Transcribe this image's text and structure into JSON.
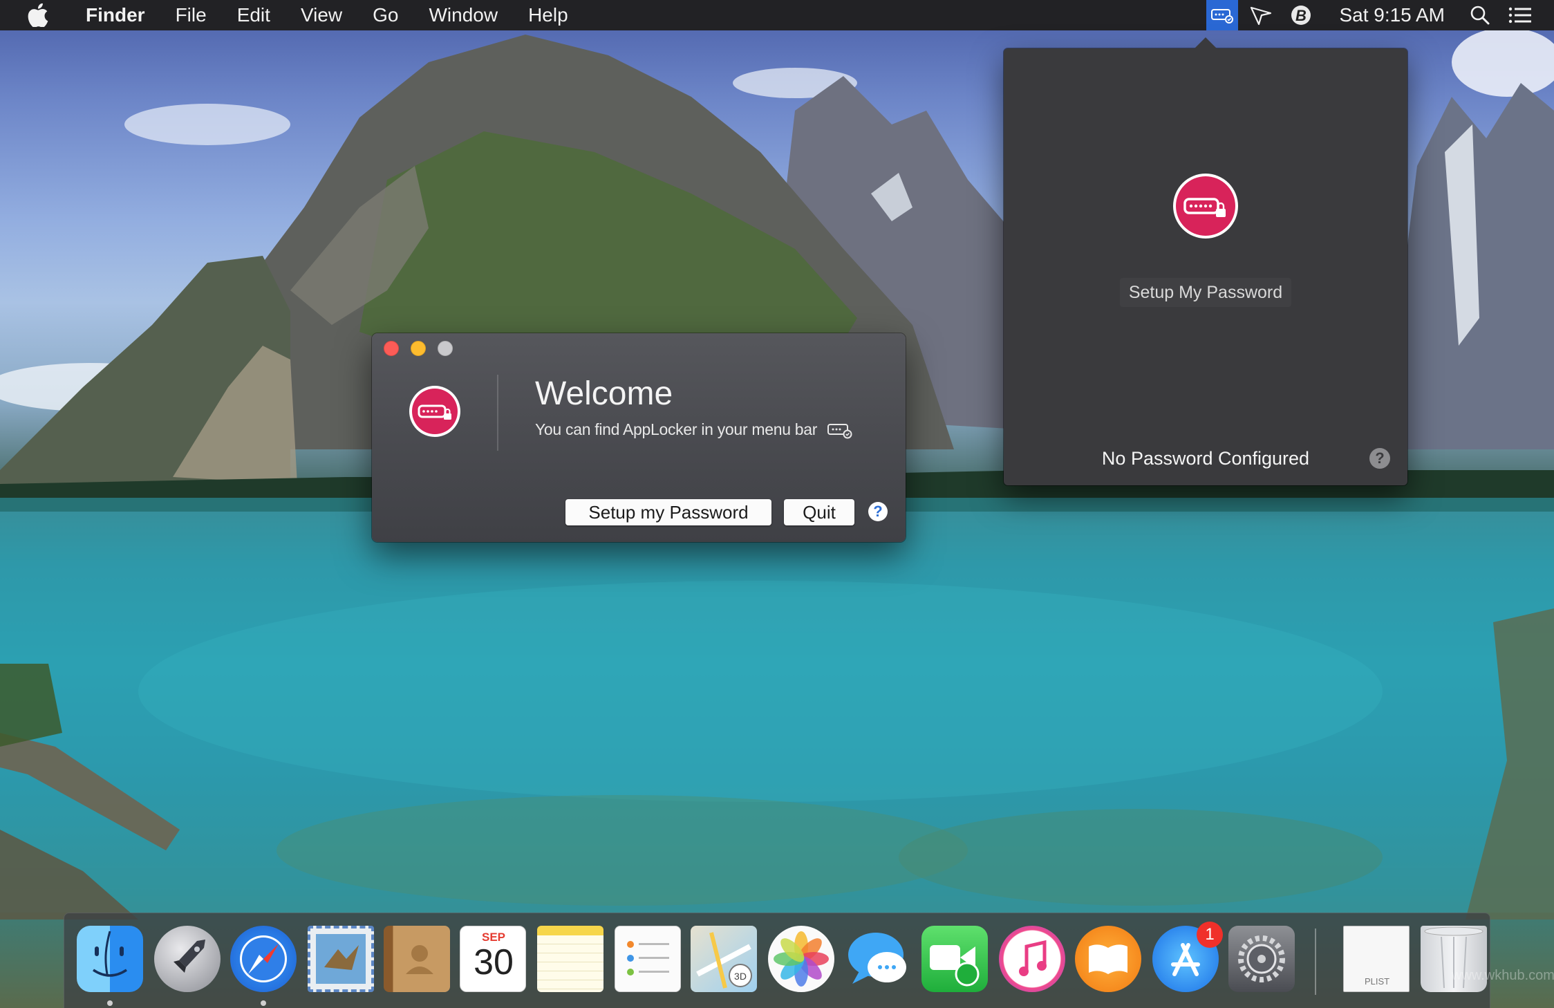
{
  "menubar": {
    "app_name": "Finder",
    "menus": [
      "File",
      "Edit",
      "View",
      "Go",
      "Window",
      "Help"
    ],
    "clock": "Sat 9:15 AM",
    "status_icons": [
      "applocker-icon",
      "location-arrow-icon",
      "b-circle-icon",
      "search-icon",
      "list-icon"
    ]
  },
  "welcome_window": {
    "title": "Welcome",
    "subtitle": "You can find AppLocker in your menu bar",
    "setup_button": "Setup my Password",
    "quit_button": "Quit",
    "help_symbol": "?"
  },
  "popover": {
    "setup_link": "Setup My Password",
    "status": "No Password Configured",
    "help_symbol": "?"
  },
  "dock": {
    "calendar_month": "SEP",
    "calendar_day": "30",
    "app_store_badge": "1",
    "plist_label": "PLIST",
    "apps": [
      "finder",
      "launchpad",
      "safari",
      "mail",
      "contacts",
      "calendar",
      "notes",
      "reminders",
      "maps",
      "photos",
      "messages",
      "facetime",
      "itunes",
      "ibooks",
      "app-store",
      "system-preferences",
      "plist-file",
      "trash"
    ]
  },
  "watermark": "www.wkhub.com",
  "colors": {
    "accent_pink": "#d8235a",
    "menubar_highlight": "#2a68d4",
    "window_bg": "#4a4b50",
    "popover_bg": "#3a3a3d"
  }
}
